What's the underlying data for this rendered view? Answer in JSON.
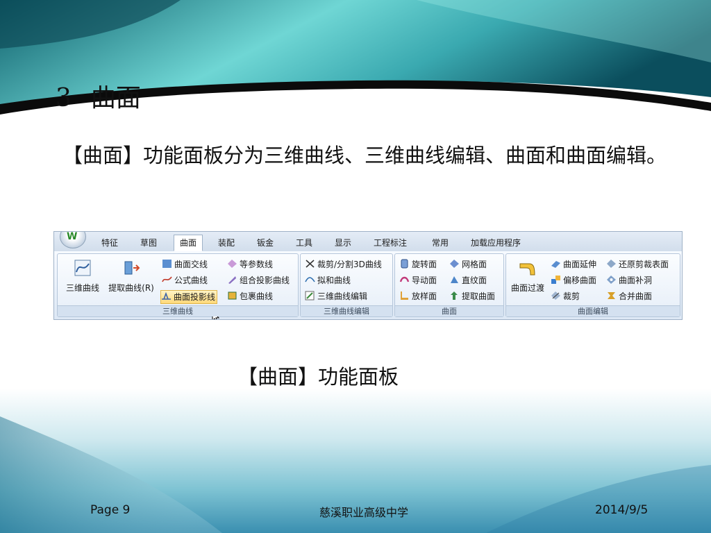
{
  "slide": {
    "title_number": "3",
    "title": "曲面",
    "body": "【曲面】功能面板分为三维曲线、三维曲线编辑、曲面和曲面编辑。",
    "caption": "【曲面】功能面板"
  },
  "ribbon": {
    "tabs": [
      "特征",
      "草图",
      "曲面",
      "装配",
      "钣金",
      "工具",
      "显示",
      "工程标注",
      "常用",
      "加载应用程序"
    ],
    "active_tab": "曲面",
    "groups": {
      "curve3d": {
        "label": "三维曲线",
        "big": [
          "三维曲线",
          "提取曲线(R)"
        ],
        "small": [
          "曲面交线",
          "等参数线",
          "公式曲线",
          "组合投影曲线",
          "曲面投影线",
          "包裹曲线"
        ]
      },
      "curve_edit": {
        "label": "三维曲线编辑",
        "small": [
          "裁剪/分割3D曲线",
          "拟和曲线",
          "三维曲线编辑"
        ]
      },
      "surface": {
        "label": "曲面",
        "small": [
          "旋转面",
          "网格面",
          "导动面",
          "直纹面",
          "放样面",
          "提取曲面"
        ]
      },
      "surface_edit": {
        "label": "曲面编辑",
        "big": [
          "曲面过渡"
        ],
        "small": [
          "曲面延伸",
          "还原剪裁表面",
          "偏移曲面",
          "曲面补洞",
          "裁剪",
          "合并曲面"
        ]
      }
    }
  },
  "footer": {
    "page": "Page 9",
    "school": "慈溪职业高级中学",
    "date": "2014/9/5"
  }
}
